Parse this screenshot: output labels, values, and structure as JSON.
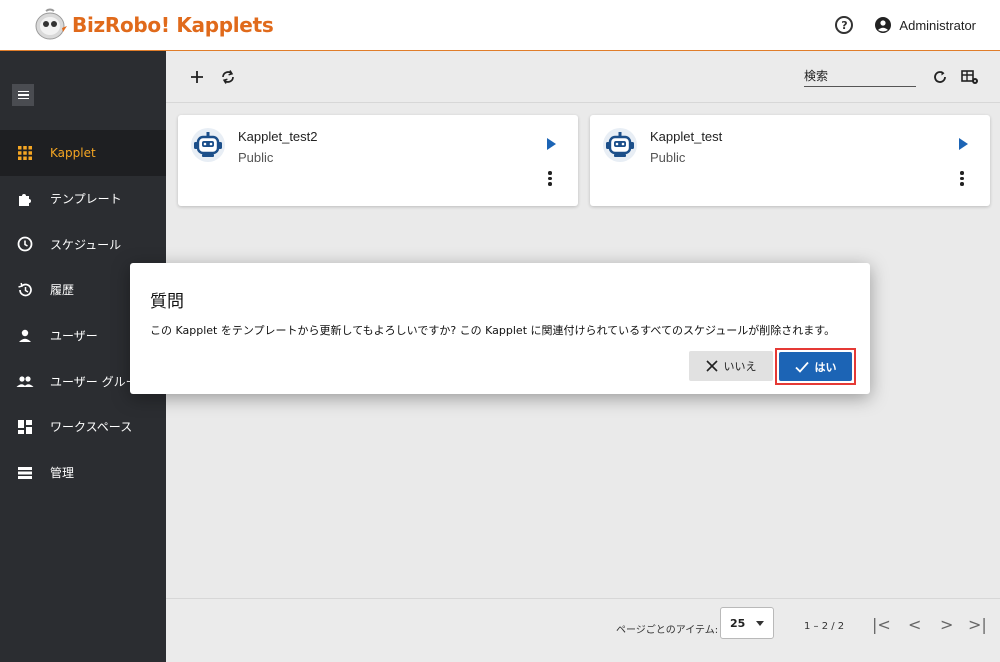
{
  "header": {
    "logo_text": "BizRobo! Kapplets",
    "help_icon": "question-circle-icon",
    "user_icon": "account-circle-icon",
    "user_name": "Administrator"
  },
  "sidebar": {
    "menu_icon": "hamburger-menu-icon",
    "items": [
      {
        "label": "Kapplet",
        "icon": "grid-icon",
        "active": true
      },
      {
        "label": "テンプレート",
        "icon": "puzzle-icon",
        "active": false
      },
      {
        "label": "スケジュール",
        "icon": "clock-icon",
        "active": false
      },
      {
        "label": "履歴",
        "icon": "history-icon",
        "active": false
      },
      {
        "label": "ユーザー",
        "icon": "person-icon",
        "active": false
      },
      {
        "label": "ユーザー グループ",
        "icon": "people-icon",
        "active": false
      },
      {
        "label": "ワークスペース",
        "icon": "dashboard-icon",
        "active": false
      },
      {
        "label": "管理",
        "icon": "storage-icon",
        "active": false
      }
    ]
  },
  "toolbar": {
    "add_icon": "plus-icon",
    "sync_icon": "sync-icon",
    "search_placeholder": "検索",
    "refresh_icon": "refresh-icon",
    "layout_icon": "table-settings-icon"
  },
  "cards": [
    {
      "title": "Kapplet_test2",
      "subtitle": "Public",
      "avatar_icon": "robot-avatar-icon",
      "run_icon": "play-icon",
      "more_icon": "more-vert-icon"
    },
    {
      "title": "Kapplet_test",
      "subtitle": "Public",
      "avatar_icon": "robot-avatar-icon",
      "run_icon": "play-icon",
      "more_icon": "more-vert-icon"
    }
  ],
  "footer": {
    "items_per_page_label": "ページごとのアイテム:",
    "items_per_page_value": "25",
    "range": "1 – 2 / 2",
    "first_page": "|<",
    "prev_page": "<",
    "next_page": ">",
    "last_page": ">|"
  },
  "dialog": {
    "title": "質問",
    "message": "この Kapplet をテンプレートから更新してもよろしいですか? この Kapplet に関連付けられているすべてのスケジュールが削除されます。",
    "no_label": "いいえ",
    "no_icon": "close-icon",
    "yes_label": "はい",
    "yes_icon": "check-icon",
    "highlight_color": "#e53935",
    "primary_color": "#1c64b5"
  }
}
